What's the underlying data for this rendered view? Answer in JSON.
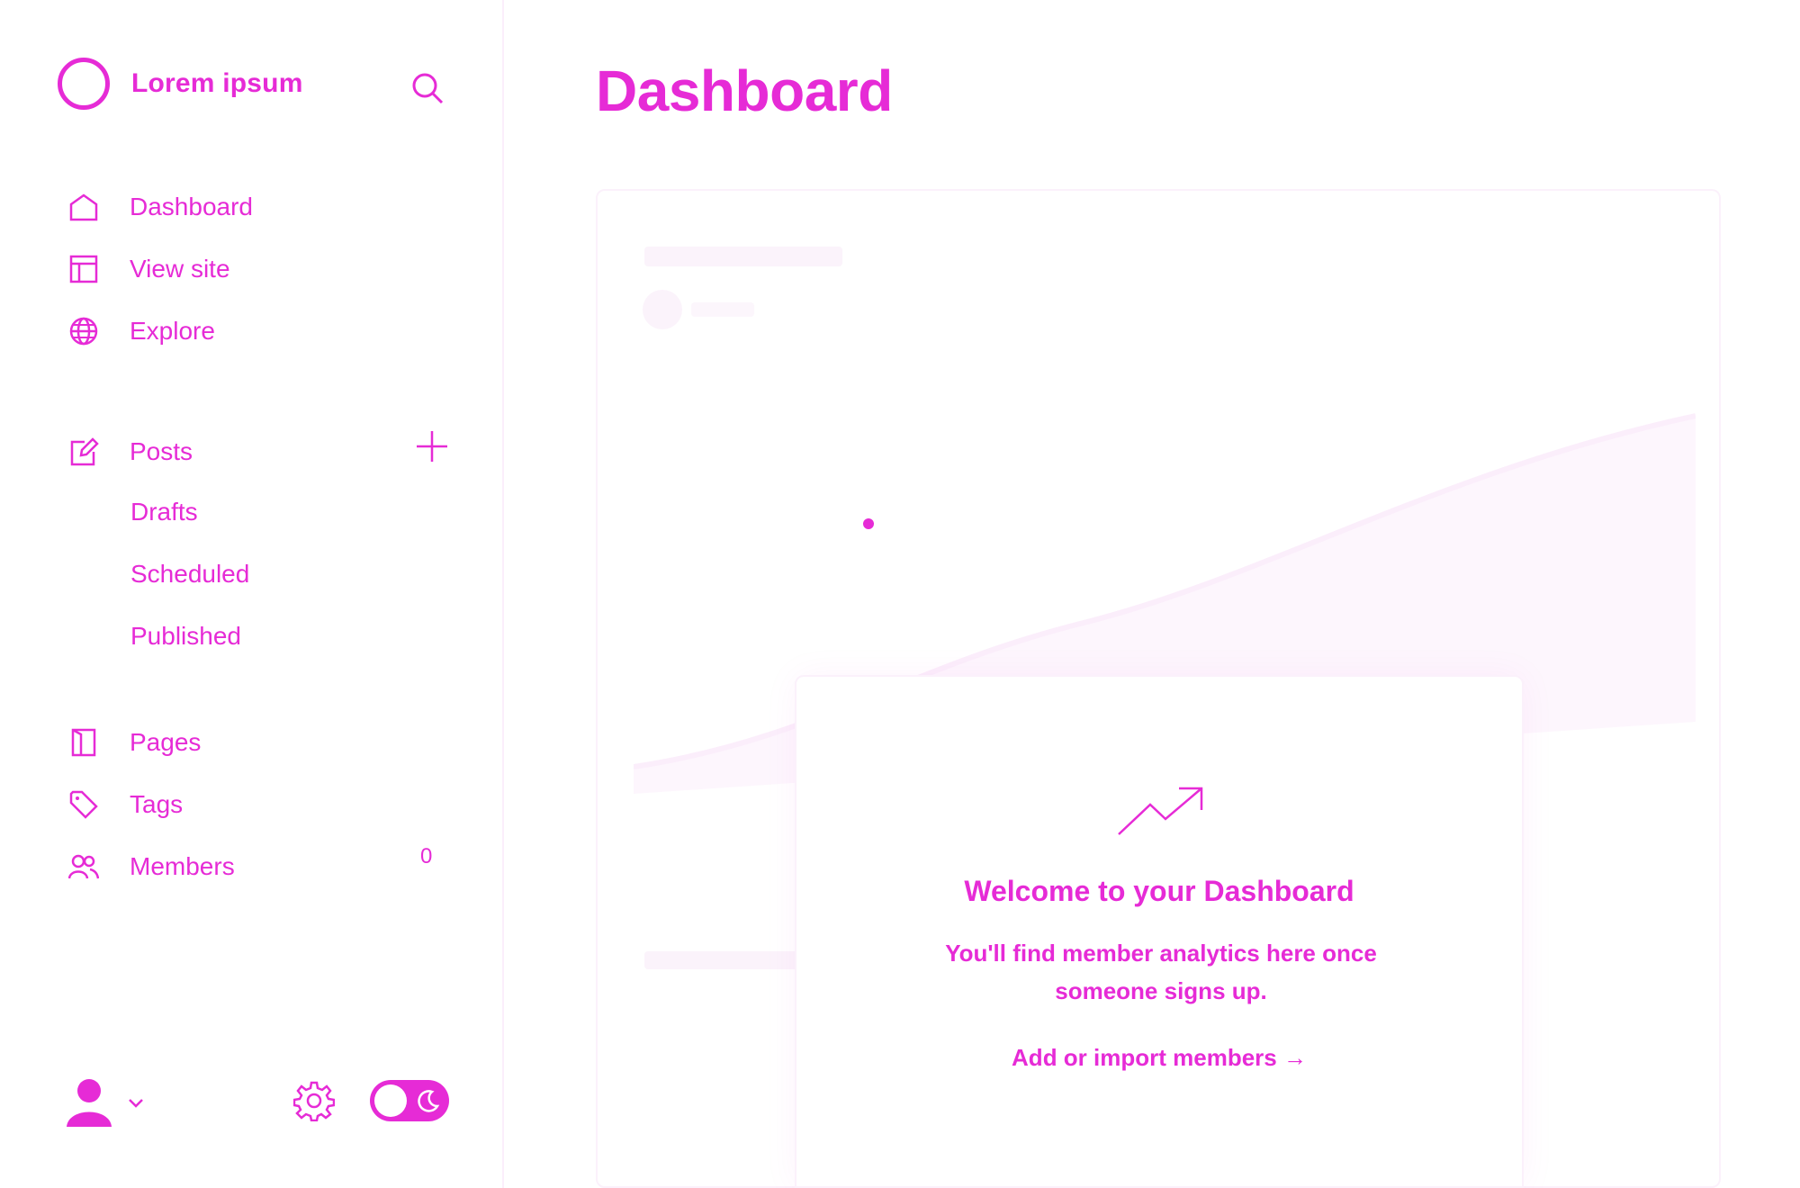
{
  "brand": {
    "name": "Lorem ipsum"
  },
  "nav": {
    "dashboard": "Dashboard",
    "view_site": "View site",
    "explore": "Explore",
    "posts": "Posts",
    "drafts": "Drafts",
    "scheduled": "Scheduled",
    "published": "Published",
    "pages": "Pages",
    "tags": "Tags",
    "members": "Members",
    "members_count": "0"
  },
  "main": {
    "title": "Dashboard",
    "welcome_title": "Welcome to your Dashboard",
    "welcome_text": "You'll find member analytics here once someone signs up.",
    "cta": "Add or import members →"
  },
  "colors": {
    "accent": "#e62bd6",
    "ghost": "#fbf3fb"
  },
  "icons": [
    "logo-icon",
    "search-icon",
    "home-icon",
    "layout-icon",
    "globe-icon",
    "edit-icon",
    "plus-icon",
    "page-icon",
    "tag-icon",
    "members-icon",
    "avatar-icon",
    "chevron-down-icon",
    "gear-icon",
    "moon-icon",
    "trend-icon"
  ]
}
